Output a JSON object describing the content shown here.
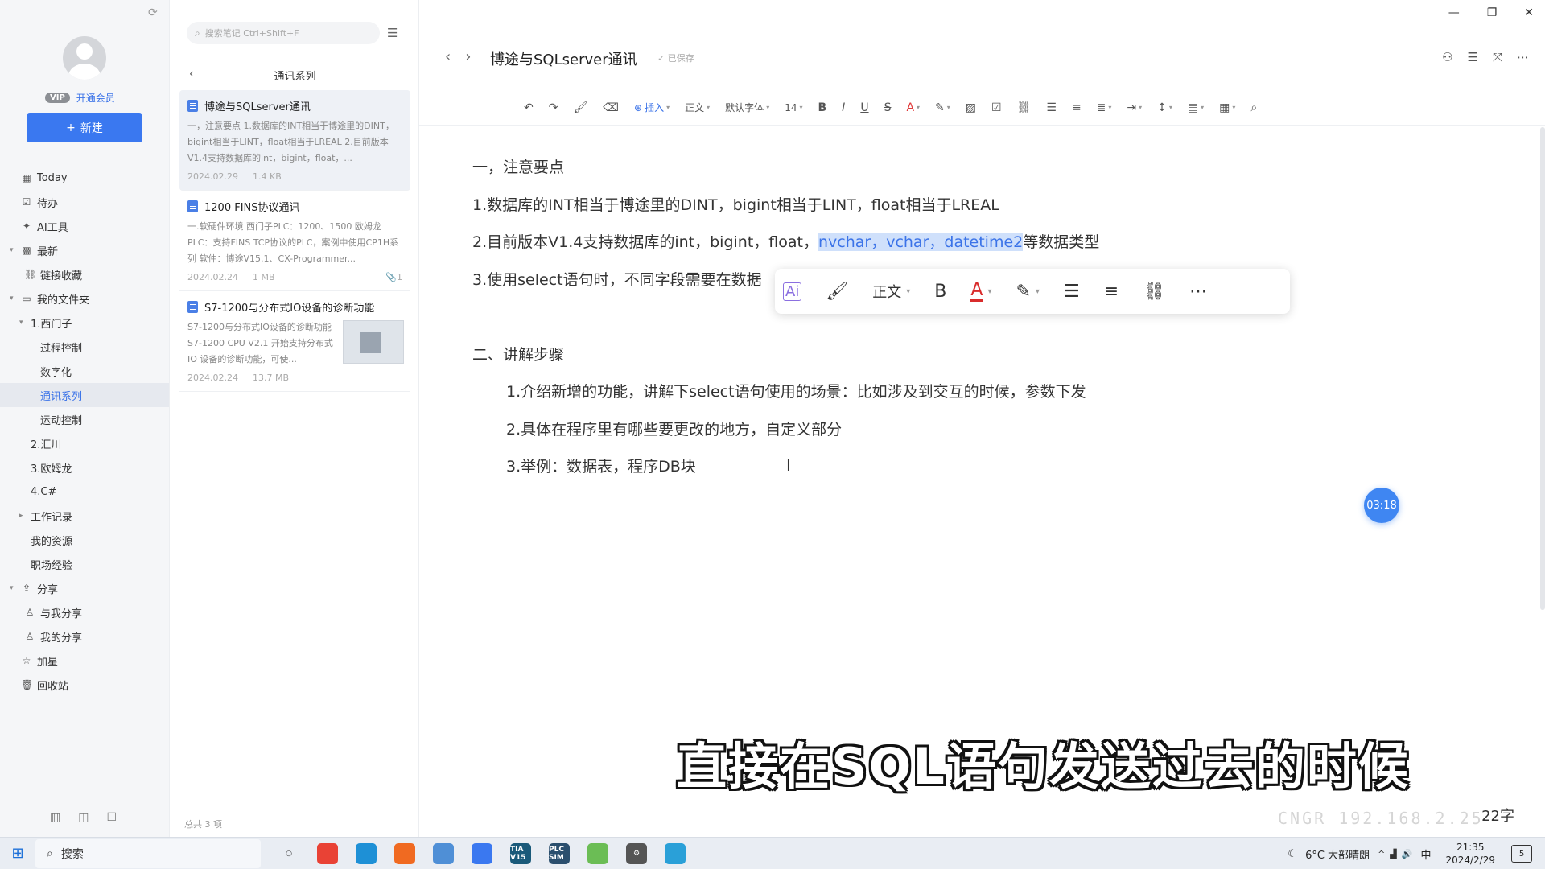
{
  "sidebar": {
    "vip_badge": "VIP",
    "vip_link": "开通会员",
    "new_button": "新建",
    "nav": [
      {
        "label": "Today",
        "icon": "calendar-icon",
        "level": 0,
        "arrow": ""
      },
      {
        "label": "待办",
        "icon": "checkbox-icon",
        "level": 0,
        "arrow": ""
      },
      {
        "label": "AI工具",
        "icon": "ai-icon",
        "level": 0,
        "arrow": ""
      },
      {
        "label": "最新",
        "icon": "grid-icon",
        "level": 0,
        "arrow": "▾"
      },
      {
        "label": "链接收藏",
        "icon": "link-icon",
        "level": 1,
        "arrow": ""
      },
      {
        "label": "我的文件夹",
        "icon": "folder-icon",
        "level": 0,
        "arrow": "▾"
      },
      {
        "label": "1.西门子",
        "icon": "",
        "level": 1,
        "arrow": "▾"
      },
      {
        "label": "过程控制",
        "icon": "",
        "level": 2,
        "arrow": ""
      },
      {
        "label": "数字化",
        "icon": "",
        "level": 2,
        "arrow": ""
      },
      {
        "label": "通讯系列",
        "icon": "",
        "level": 2,
        "arrow": "",
        "selected": true
      },
      {
        "label": "运动控制",
        "icon": "",
        "level": 2,
        "arrow": ""
      },
      {
        "label": "2.汇川",
        "icon": "",
        "level": 1,
        "arrow": ""
      },
      {
        "label": "3.欧姆龙",
        "icon": "",
        "level": 1,
        "arrow": ""
      },
      {
        "label": "4.C#",
        "icon": "",
        "level": 1,
        "arrow": ""
      },
      {
        "label": "工作记录",
        "icon": "",
        "level": 1,
        "arrow": "▸"
      },
      {
        "label": "我的资源",
        "icon": "",
        "level": 1,
        "arrow": ""
      },
      {
        "label": "职场经验",
        "icon": "",
        "level": 1,
        "arrow": ""
      },
      {
        "label": "分享",
        "icon": "share-icon",
        "level": 0,
        "arrow": "▾"
      },
      {
        "label": "与我分享",
        "icon": "user-icon",
        "level": 1,
        "arrow": ""
      },
      {
        "label": "我的分享",
        "icon": "user-icon",
        "level": 1,
        "arrow": ""
      },
      {
        "label": "加星",
        "icon": "star-icon",
        "level": 0,
        "arrow": ""
      },
      {
        "label": "回收站",
        "icon": "trash-icon",
        "level": 0,
        "arrow": ""
      }
    ]
  },
  "notelist": {
    "search_placeholder": "搜索笔记 Ctrl+Shift+F",
    "folder_title": "通讯系列",
    "total": "总共 3 项",
    "notes": [
      {
        "title": "博途与SQLserver通讯",
        "snippet": "一，注意要点 1.数据库的INT相当于博途里的DINT，bigint相当于LINT，float相当于LREAL 2.目前版本V1.4支持数据库的int，bigint，float，...",
        "date": "2024.02.29",
        "size": "1.4 KB"
      },
      {
        "title": "1200 FINS协议通讯",
        "snippet": "一.软硬件环境 西门子PLC：1200、1500 欧姆龙PLC：支持FINS TCP协议的PLC，案例中使用CP1H系列 软件：博途V15.1、CX-Programmer...",
        "date": "2024.02.24",
        "size": "1 MB",
        "attachments": "1"
      },
      {
        "title": "S7-1200与分布式IO设备的诊断功能",
        "snippet": "S7-1200与分布式IO设备的诊断功能 S7-1200 CPU V2.1 开始支持分布式 IO 设备的诊断功能，可使...",
        "date": "2024.02.24",
        "size": "13.7 MB"
      }
    ]
  },
  "editor": {
    "title": "博途与SQLserver通讯",
    "saved": "已保存",
    "toolbar": {
      "insert": "插入",
      "style": "正文",
      "font": "默认字体",
      "size": "14"
    },
    "floatbar": {
      "style": "正文"
    },
    "lines": {
      "l1": "一，注意要点",
      "l2": "1.数据库的INT相当于博途里的DINT，bigint相当于LINT，float相当于LREAL",
      "l3_pre": "2.目前版本V1.4支持数据库的int，bigint，float，",
      "l3_hl": "nvchar，vchar，datetime2",
      "l3_post": "等数据类型",
      "l4": "3.使用select语句时，不同字段需要在数据",
      "l5": "二、讲解步骤",
      "l6": "1.介绍新增的功能，讲解下select语句使用的场景：比如涉及到交互的时候，参数下发",
      "l7": "2.具体在程序里有哪些要更改的地方，自定义部分",
      "l8": "3.举例：数据表，程序DB块"
    },
    "timer": "03:18",
    "subtitle": "直接在SQL语句发送过去的时候",
    "wordcount": "22字",
    "watermark": "CNGR  192.168.2.25"
  },
  "taskbar": {
    "search": "搜索",
    "weather": "6°C 大部晴朗",
    "ime": "中",
    "time": "21:35",
    "date": "2024/2/29",
    "notifications": "5",
    "apps": [
      {
        "name": "task-view",
        "label": "○",
        "color": "#333333"
      },
      {
        "name": "chrome",
        "label": "",
        "color": "#e94235"
      },
      {
        "name": "edge",
        "label": "",
        "color": "#1e90d6"
      },
      {
        "name": "firefox",
        "label": "",
        "color": "#f06a21"
      },
      {
        "name": "files",
        "label": "",
        "color": "#4f8fd6"
      },
      {
        "name": "notes",
        "label": "",
        "color": "#3a78f0"
      },
      {
        "name": "tia-portal",
        "label": "TIA V15",
        "color": "#1a5a7a"
      },
      {
        "name": "plcsim",
        "label": "PLC SIM",
        "color": "#2b4f6e"
      },
      {
        "name": "app-green",
        "label": "",
        "color": "#6bbd55"
      },
      {
        "name": "settings",
        "label": "⚙",
        "color": "#555555"
      },
      {
        "name": "remote",
        "label": "",
        "color": "#2aa0d8"
      }
    ]
  },
  "colors": {
    "accent": "#3a78f0",
    "highlight": "#cfe0fb"
  }
}
